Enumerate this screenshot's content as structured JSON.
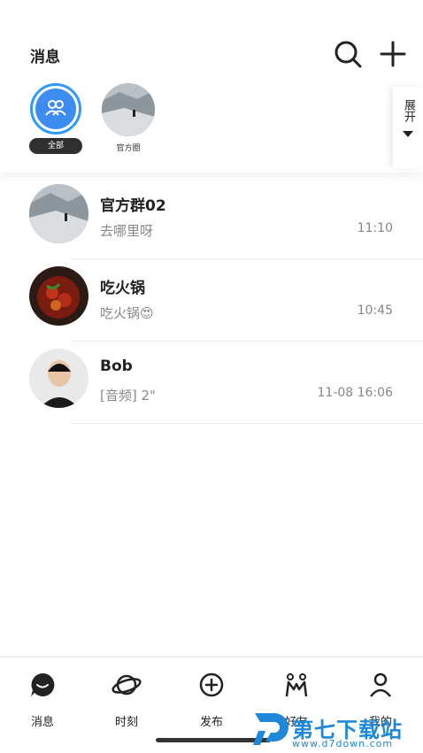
{
  "header": {
    "title": "消息"
  },
  "top_circles": [
    {
      "label": "全部"
    },
    {
      "label": "官方圈"
    }
  ],
  "expand": {
    "label": "展开"
  },
  "chats": [
    {
      "name": "官方群02",
      "message": "去哪里呀",
      "time": "11:10"
    },
    {
      "name": "吃火锅",
      "message": "吃火锅😍",
      "time": "10:45"
    },
    {
      "name": "Bob",
      "message": "[音频] 2\"",
      "time": "11-08 16:06"
    }
  ],
  "tabs": [
    {
      "label": "消息"
    },
    {
      "label": "时刻"
    },
    {
      "label": "发布"
    },
    {
      "label": "好友"
    },
    {
      "label": "我的"
    }
  ],
  "watermark": {
    "title": "第七下载站",
    "url": "www.d7down.com"
  }
}
